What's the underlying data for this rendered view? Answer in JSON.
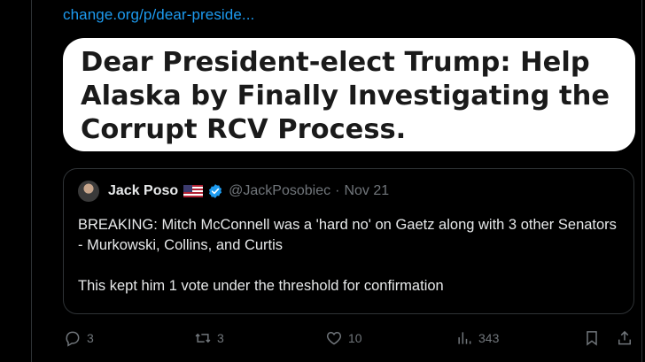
{
  "post": {
    "link_url": "change.org/p/dear-preside...",
    "card_title": "Dear President-elect Trump: Help Alaska by Finally Investigating the Corrupt RCV Process."
  },
  "quote": {
    "author_name": "Jack Poso",
    "author_handle": "@JackPosobiec",
    "separator": "·",
    "date": "Nov 21",
    "paragraph1": "BREAKING: Mitch McConnell was a 'hard no' on Gaetz along with 3 other Senators - Murkowski, Collins, and Curtis",
    "paragraph2": "This kept him 1 vote under the threshold for confirmation"
  },
  "actions": {
    "replies": "3",
    "reposts": "3",
    "likes": "10",
    "views": "343"
  },
  "icons": [
    "reply-icon",
    "repost-icon",
    "like-icon",
    "views-icon",
    "bookmark-icon",
    "share-icon",
    "verified-icon",
    "us-flag-icon"
  ],
  "colors": {
    "link": "#1d9bf0",
    "muted": "#71767b",
    "background": "#000000",
    "card": "#ffffff"
  }
}
